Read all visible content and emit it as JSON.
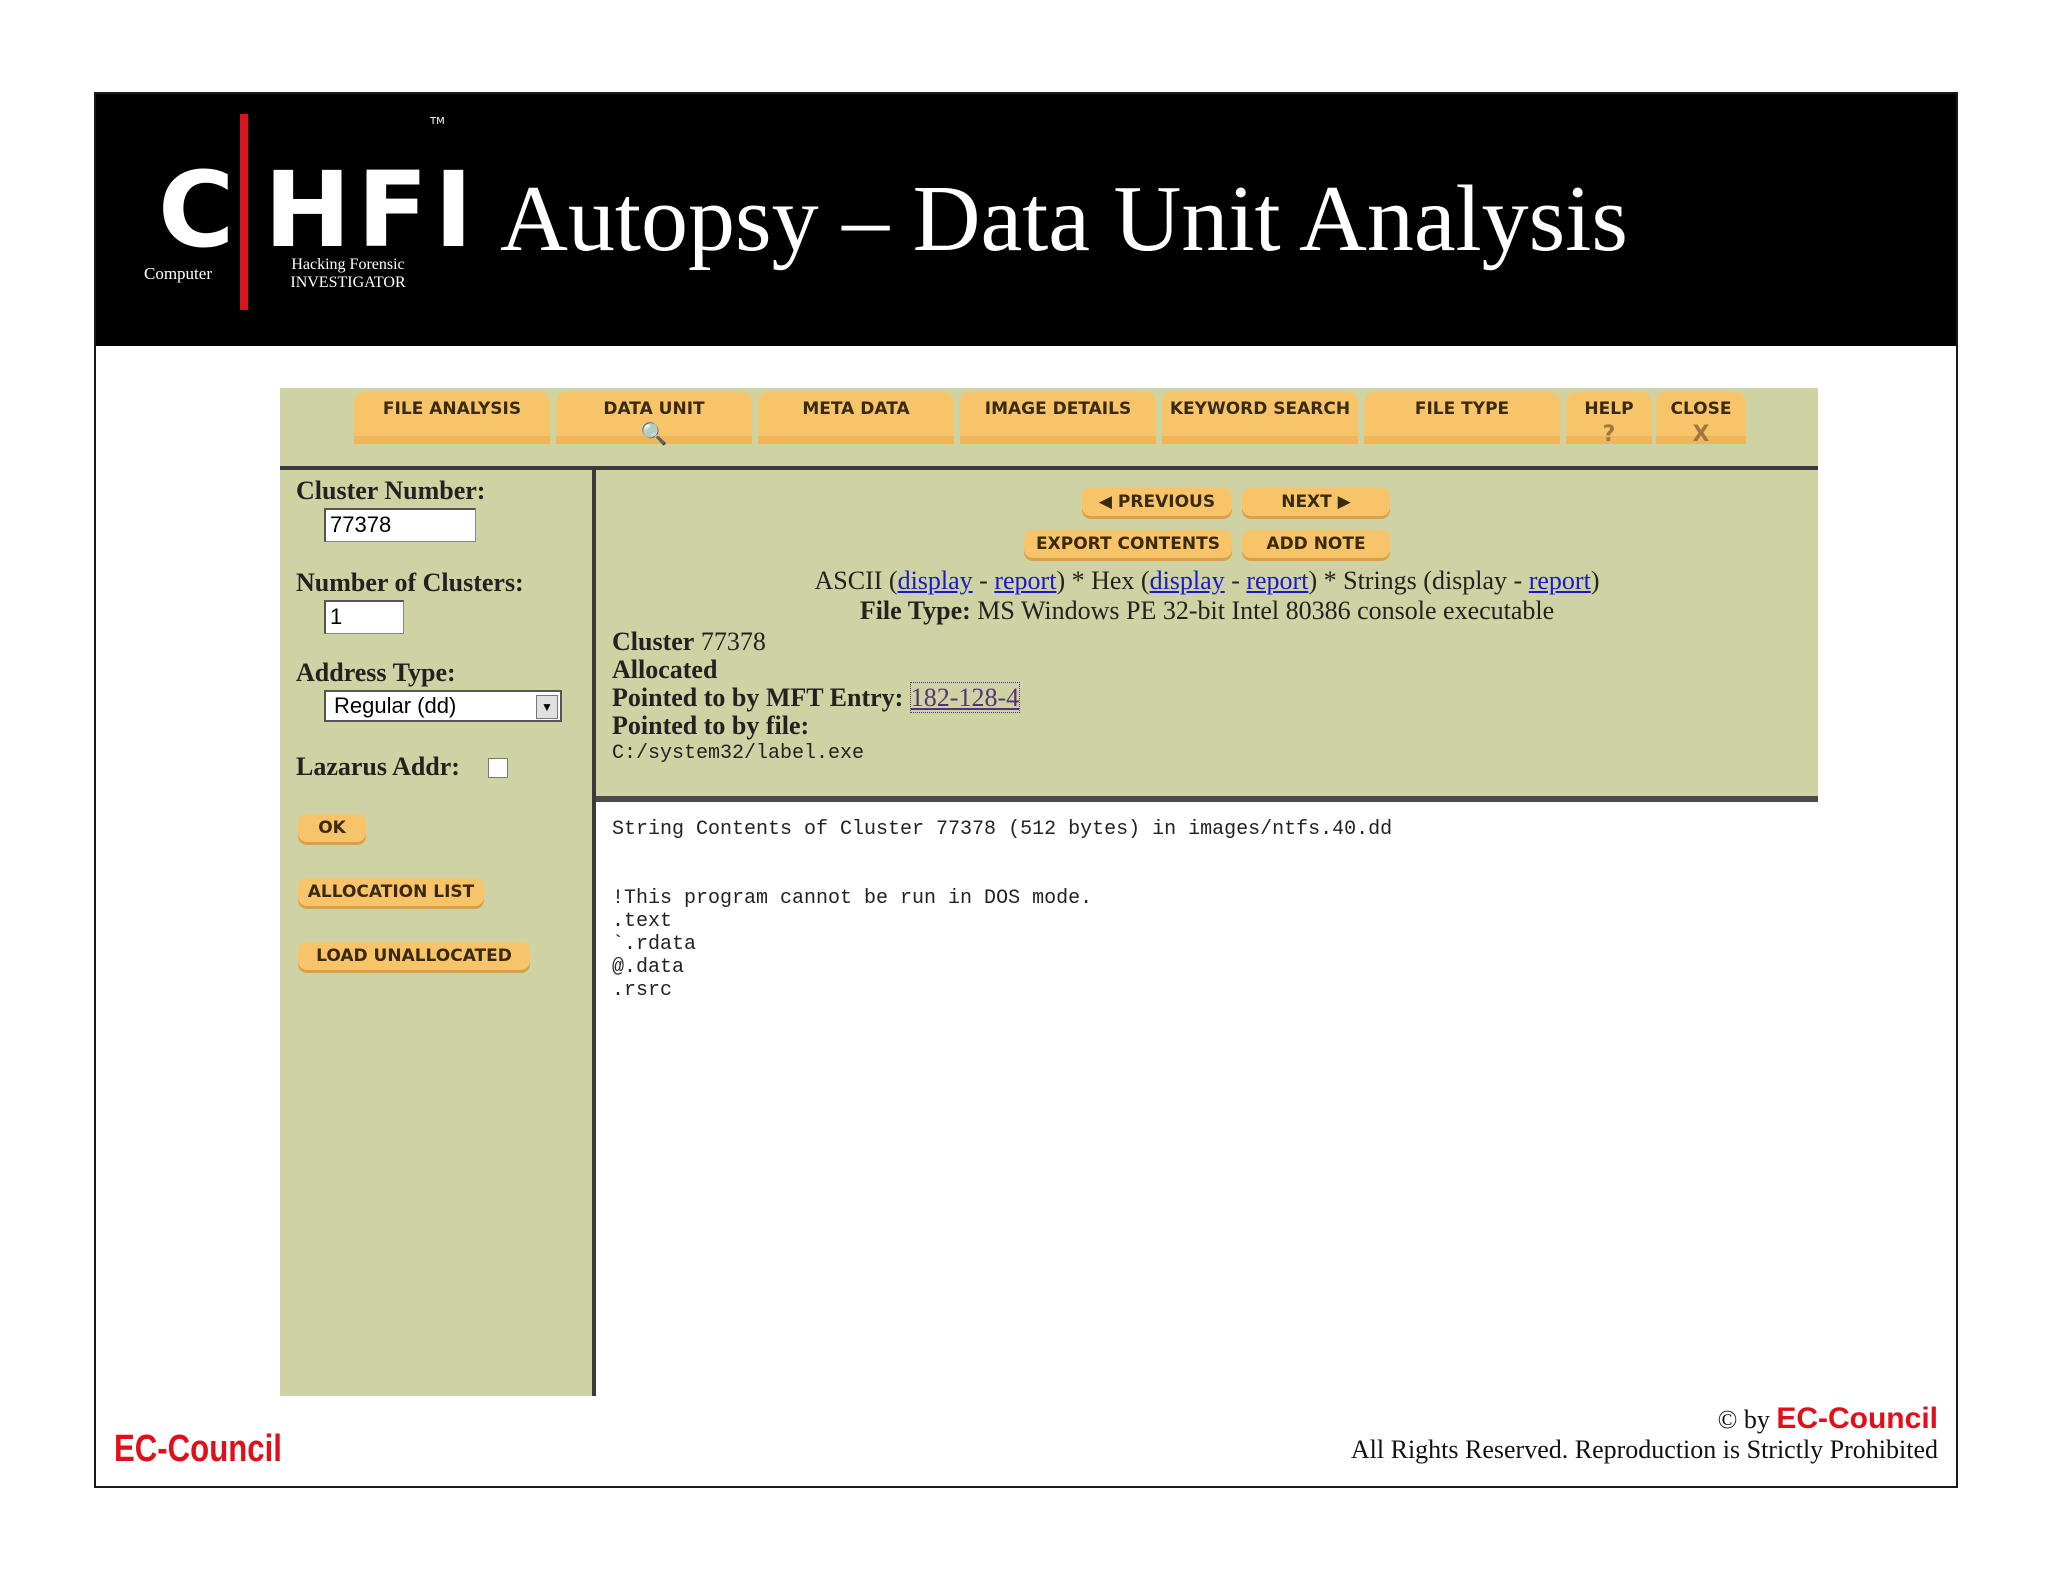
{
  "slide": {
    "title": "Autopsy – Data Unit Analysis",
    "logo": {
      "c": "C",
      "hfi": "HFI",
      "tm": "TM",
      "computer": "Computer",
      "line1": "Hacking Forensic",
      "line2": "INVESTIGATOR"
    },
    "footer_brand": "EC-Council",
    "copyright_prefix": "© by",
    "copyright_brand": "EC-Council",
    "rights": "All Rights Reserved. Reproduction is Strictly Prohibited"
  },
  "nav": {
    "tabs": [
      {
        "label": "FILE ANALYSIS",
        "sub": ""
      },
      {
        "label": "DATA UNIT",
        "sub": "🔍"
      },
      {
        "label": "META DATA",
        "sub": ""
      },
      {
        "label": "IMAGE DETAILS",
        "sub": ""
      },
      {
        "label": "KEYWORD SEARCH",
        "sub": ""
      },
      {
        "label": "FILE TYPE",
        "sub": ""
      },
      {
        "label": "HELP",
        "sub": "?"
      },
      {
        "label": "CLOSE",
        "sub": "X"
      }
    ]
  },
  "left": {
    "cluster_number_label": "Cluster Number:",
    "cluster_number_value": "77378",
    "num_clusters_label": "Number of Clusters:",
    "num_clusters_value": "1",
    "address_type_label": "Address Type:",
    "address_type_value": "Regular (dd)",
    "lazarus_label": "Lazarus Addr:",
    "ok": "OK",
    "allocation_list": "ALLOCATION LIST",
    "load_unallocated": "LOAD UNALLOCATED"
  },
  "top": {
    "previous": "PREVIOUS",
    "next": "NEXT",
    "export_contents": "EXPORT CONTENTS",
    "add_note": "ADD NOTE",
    "ascii": "ASCII (",
    "display": "display",
    "dash": " - ",
    "report": "report",
    "hex": ") * Hex (",
    "strings": ") * Strings (display - ",
    "close_paren": ")",
    "file_type_label": "File Type:",
    "file_type_value": " MS Windows PE 32-bit Intel 80386 console executable",
    "cluster_line": "Cluster 77378",
    "allocated": "Allocated",
    "mft_label": "Pointed to by MFT Entry:",
    "mft_value": "182-128-4",
    "file_label": "Pointed to by file:",
    "file_path": "C:/system32/label.exe"
  },
  "contents": {
    "text": "String Contents of Cluster 77378 (512 bytes) in images/ntfs.40.dd\n\n\n!This program cannot be run in DOS mode.\n.text\n`.rdata\n@.data\n.rsrc"
  }
}
